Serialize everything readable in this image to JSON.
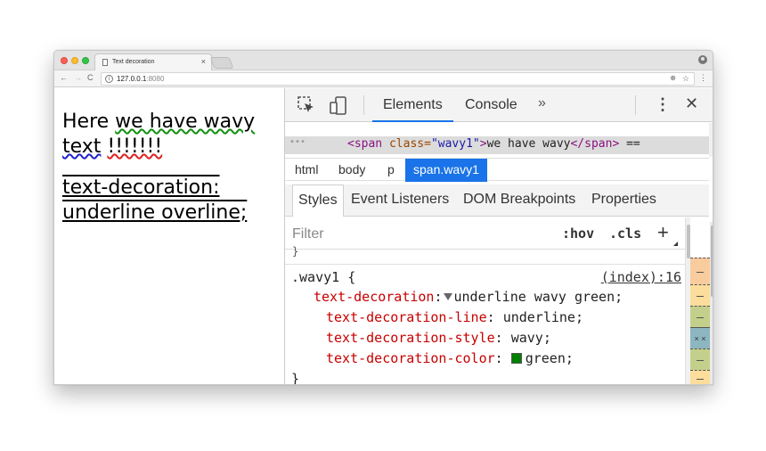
{
  "browser": {
    "tab_title": "Text decoration",
    "tab_close": "×",
    "url_host": "127.0.0.1",
    "url_port": ":8080",
    "info_icon": "i",
    "zoom_icon": "⊕",
    "star_icon": "☆",
    "menu_icon": "⋮",
    "back_icon": "←",
    "forward_icon": "→",
    "reload_icon": "C"
  },
  "page": {
    "text_before": "Here ",
    "wavy_green": "we have wavy",
    "wavy_blue": "text",
    "wavy_red": "!!!!!!!",
    "deco_text": "text-decoration: underline overline;"
  },
  "devtools": {
    "tabs": {
      "elements": "Elements",
      "console": "Console",
      "more": "»"
    },
    "menu": "⋮",
    "close": "✕",
    "dom": {
      "quote": "\"",
      "dots": "•••",
      "tag_open": "<span",
      "attr_name": " class=",
      "attr_value": "\"wavy1\"",
      "tag_open_end": ">",
      "text": "we have wavy",
      "tag_close": "</span>",
      "tail": " =="
    },
    "breadcrumbs": [
      "html",
      "body",
      "p",
      "span.wavy1"
    ],
    "subtabs": [
      "Styles",
      "Event Listeners",
      "DOM Breakpoints",
      "Properties"
    ],
    "filter": {
      "placeholder": "Filter",
      "hov": ":hov",
      "cls": ".cls",
      "add": "+"
    },
    "rule": {
      "selector": ".wavy1 {",
      "source": "(index):16",
      "shorthand_prop": "text-decoration",
      "shorthand_value": "underline wavy green;",
      "longhands": [
        {
          "prop": "text-decoration-line",
          "value": "underline;"
        },
        {
          "prop": "text-decoration-style",
          "value": "wavy;"
        },
        {
          "prop": "text-decoration-color",
          "value": "green;"
        }
      ],
      "close": "}",
      "prev_brace": "}"
    },
    "boxmodel_x": "× ×"
  },
  "colors": {
    "accent": "#1a73e8",
    "wavy_green": "#109010",
    "wavy_blue": "#2222cc",
    "wavy_red": "#dd2222",
    "swatch_green": "#008000"
  }
}
